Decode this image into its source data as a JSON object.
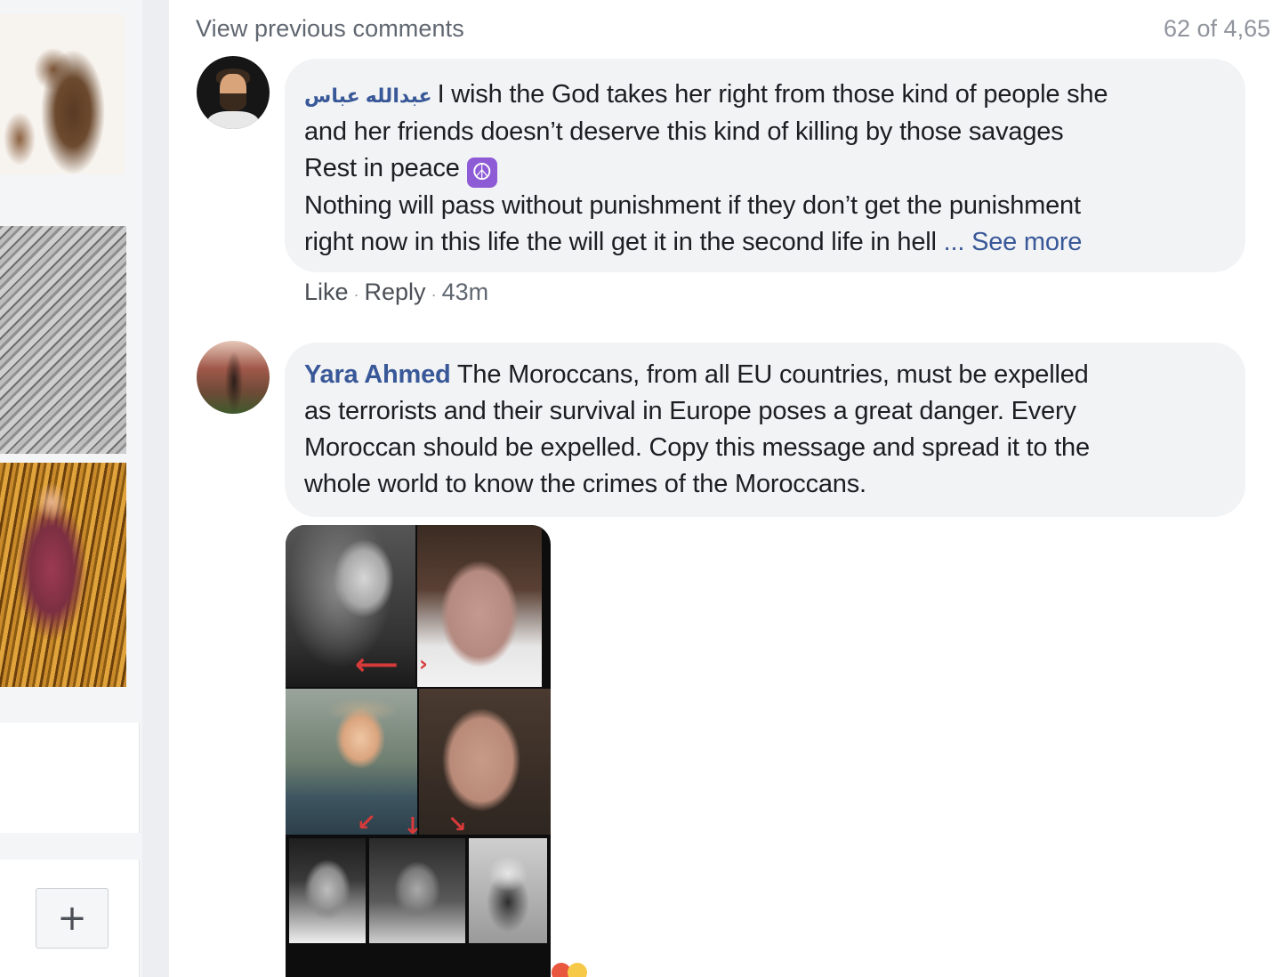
{
  "comments_header": {
    "view_previous": "View previous comments",
    "count": "62 of 4,65"
  },
  "comments": [
    {
      "author": "عبدالله عباس",
      "lines": [
        "I wish the God takes her right from those kind of people she",
        "and her friends doesn’t deserve this kind of killing by those savages",
        "Rest in peace",
        "Nothing will pass without punishment if they don’t get the punishment",
        "right now in this life the will get it in the second life in hell"
      ],
      "ellipsis": "...",
      "see_more": "See more",
      "emoji": "peace-symbol",
      "actions": {
        "like": "Like",
        "reply": "Reply",
        "time": "43m"
      }
    },
    {
      "author": "Yara Ahmed",
      "lines": [
        "The Moroccans, from all EU countries, must be expelled",
        "as terrorists and their survival in Europe poses a great danger. Every",
        "Moroccan should be expelled. Copy this message and spread it to the",
        "whole world to know the crimes of the Moroccans."
      ]
    }
  ],
  "sidebar": {
    "add_button": "+"
  },
  "colors": {
    "link": "#385898",
    "bubble": "#f2f3f5",
    "meta_text": "#606770",
    "arrow_red": "#d63a3a"
  }
}
